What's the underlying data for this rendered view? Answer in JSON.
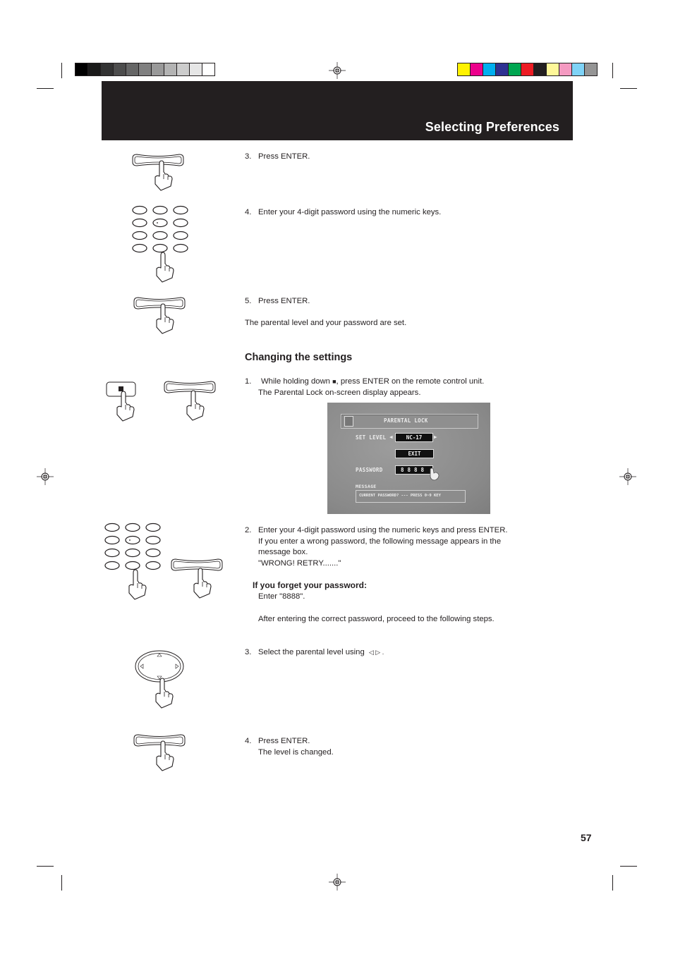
{
  "header": {
    "title": "Selecting Preferences"
  },
  "print_marks": {
    "grayscale_swatches": [
      "#000000",
      "#1a1a1a",
      "#333333",
      "#4d4d4d",
      "#666666",
      "#808080",
      "#999999",
      "#b3b3b3",
      "#cccccc",
      "#e6e6e6",
      "#ffffff"
    ],
    "color_swatches": [
      "#fff200",
      "#ec008c",
      "#00aeef",
      "#2e3192",
      "#00a651",
      "#ed1c24",
      "#231f20",
      "#fff799",
      "#f49ac1",
      "#7fd3f7",
      "#959595"
    ]
  },
  "steps_top": [
    {
      "number": "3.",
      "text": "Press ENTER."
    },
    {
      "number": "4.",
      "text": "Enter your 4-digit password using the numeric keys."
    },
    {
      "number": "5.",
      "text": "Press ENTER."
    }
  ],
  "note_set": "The parental level and your password are set.",
  "section": {
    "title": "Changing the settings",
    "step1": {
      "number": "1.",
      "line1_pre": "While holding down ",
      "stop_symbol": "■",
      "line1_post": ", press ENTER on the remote control unit.",
      "line2": "The Parental Lock on-screen display appears."
    },
    "osd": {
      "title": "PARENTAL LOCK",
      "set_level_label": "SET LEVEL",
      "set_level_value": "NC-17",
      "exit_label": "EXIT",
      "password_label": "PASSWORD",
      "password_value": "8888",
      "message_label": "MESSAGE",
      "message_text": "CURRENT PASSWORD? --- PRESS 0~9 KEY"
    },
    "step2": {
      "number": "2.",
      "lines": [
        "Enter your 4-digit password using the numeric keys and press ENTER.",
        "If you enter a wrong password, the following message appears in the",
        "message box.",
        "\"WRONG! RETRY.......\""
      ]
    },
    "forget": {
      "title": "If you forget your password:",
      "line1": "Enter \"8888\".",
      "line2": "After entering the correct password, proceed to the following steps."
    },
    "step3": {
      "number": "3.",
      "text": "Select the parental level using",
      "arrows": "◁  ▷ ."
    },
    "step4": {
      "number": "4.",
      "line1": "Press ENTER.",
      "line2": "The level is changed."
    }
  },
  "page_number": "57"
}
